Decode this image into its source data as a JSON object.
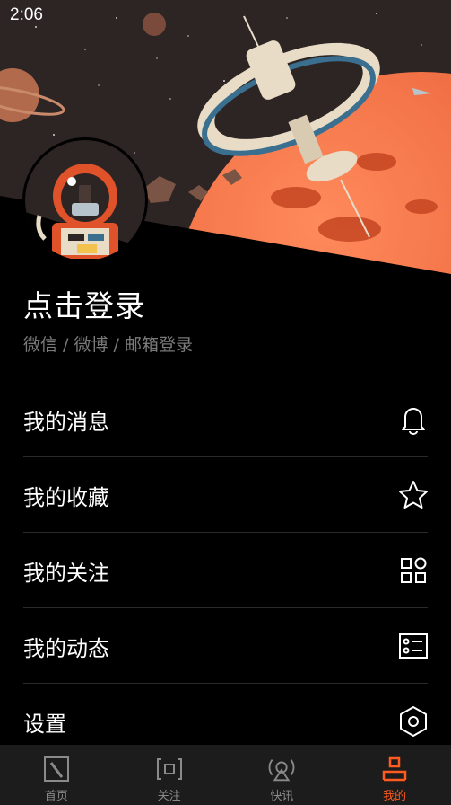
{
  "status_bar": {
    "time": "2:06"
  },
  "profile": {
    "login_title": "点击登录",
    "login_subtitle": "微信 / 微博 / 邮箱登录"
  },
  "menu": {
    "items": [
      {
        "label": "我的消息",
        "icon": "bell-icon"
      },
      {
        "label": "我的收藏",
        "icon": "star-icon"
      },
      {
        "label": "我的关注",
        "icon": "grid-icon"
      },
      {
        "label": "我的动态",
        "icon": "list-card-icon"
      },
      {
        "label": "设置",
        "icon": "hexagon-settings-icon"
      }
    ]
  },
  "tabbar": {
    "items": [
      {
        "label": "首页",
        "icon": "home-slash-icon",
        "active": false
      },
      {
        "label": "关注",
        "icon": "focus-bracket-icon",
        "active": false
      },
      {
        "label": "快讯",
        "icon": "broadcast-icon",
        "active": false
      },
      {
        "label": "我的",
        "icon": "person-icon",
        "active": true
      }
    ]
  },
  "colors": {
    "accent": "#ff5a1f",
    "background": "#000000",
    "tabbar_bg": "#1c1c1c",
    "inactive": "#8a8a8a"
  }
}
